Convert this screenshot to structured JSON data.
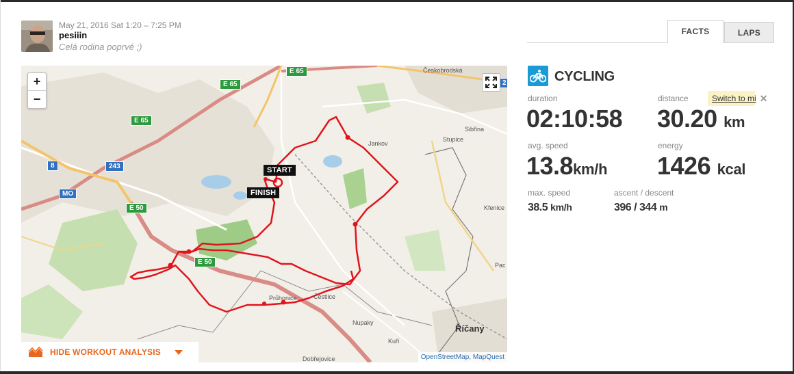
{
  "workout": {
    "date_time": "May 21, 2016 Sat 1:20 – 7:25 PM",
    "user": "pesiiin",
    "description": "Celá rodina poprvé ;)"
  },
  "tabs": [
    {
      "label": "FACTS",
      "active": true
    },
    {
      "label": "LAPS",
      "active": false
    }
  ],
  "map": {
    "zoom_in": "+",
    "zoom_out": "−",
    "start_label": "START",
    "finish_label": "FINISH",
    "attribution": "OpenStreetMap, MapQuest",
    "route_color": "#e0141c",
    "roads": {
      "e65_a": "E 65",
      "e65_b": "E 65",
      "e65_c": "E 65",
      "e50_a": "E 50",
      "e50_b": "E 50",
      "r8": "8",
      "r243": "243",
      "mo": "MO",
      "r2": "2"
    },
    "towns": {
      "jankov": "Jankov",
      "stupice": "Stupice",
      "sibrina": "Sibřina",
      "kfenice": "Kfenice",
      "pac": "Pac",
      "pruhonice": "Průhonice",
      "cestlice": "Čestlice",
      "nupaky": "Nupaky",
      "kuri": "Kuří",
      "ricany": "Říčany",
      "dobrejovice": "Dobřejovice",
      "ceskobrodska": "Českobrodská"
    }
  },
  "analysis": {
    "label": "HIDE WORKOUT ANALYSIS",
    "accent": "#e8661e"
  },
  "facts": {
    "sport": "CYCLING",
    "sport_icon": "bicycle-icon",
    "sport_color": "#1a9ad6",
    "duration": {
      "label": "duration",
      "value": "02:10:58"
    },
    "distance": {
      "label": "distance",
      "value": "30.20",
      "unit": "km"
    },
    "switch_units": "Switch to mi",
    "avg_speed": {
      "label": "avg. speed",
      "value": "13.8",
      "unit": "km/h"
    },
    "energy": {
      "label": "energy",
      "value": "1426",
      "unit": "kcal"
    },
    "max_speed": {
      "label": "max. speed",
      "value": "38.5",
      "unit": "km/h"
    },
    "ascent_descent": {
      "label": "ascent / descent",
      "value": "396 / 344",
      "unit": "m"
    }
  }
}
